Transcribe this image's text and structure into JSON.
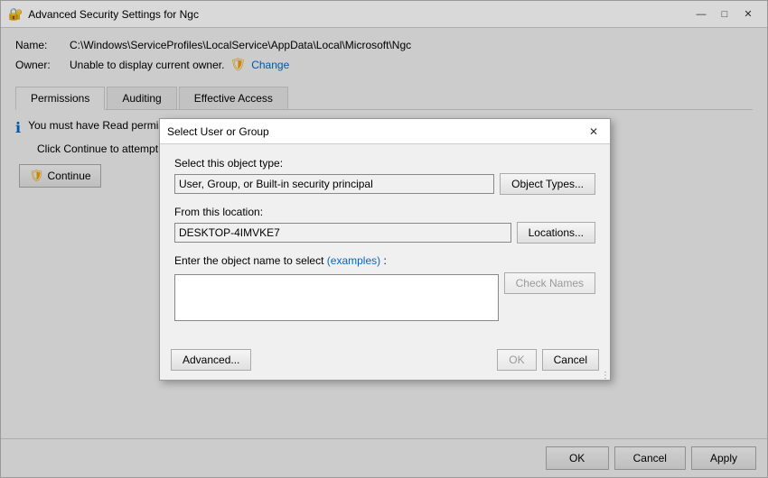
{
  "mainWindow": {
    "title": "Advanced Security Settings for Ngc",
    "titleIcon": "🔒"
  },
  "fields": {
    "nameLabel": "Name:",
    "nameValue": "C:\\Windows\\ServiceProfiles\\LocalService\\AppData\\Local\\Microsoft\\Ngc",
    "ownerLabel": "Owner:",
    "ownerValue": "Unable to display current owner.",
    "changeLink": "Change"
  },
  "tabs": [
    {
      "label": "Permissions",
      "active": true
    },
    {
      "label": "Auditing",
      "active": false
    },
    {
      "label": "Effective Access",
      "active": false
    }
  ],
  "infoText": {
    "line1": "You must have Read permissions to view the properties of this object.",
    "line2": "Click Continue to attempt the operation with administrative privileges."
  },
  "continueBtn": "Continue",
  "bottomBar": {
    "ok": "OK",
    "cancel": "Cancel",
    "apply": "Apply"
  },
  "dialog": {
    "title": "Select User or Group",
    "objectTypeLabel": "Select this object type:",
    "objectTypeValue": "User, Group, or Built-in security principal",
    "objectTypesBtn": "Object Types...",
    "locationLabel": "From this location:",
    "locationValue": "DESKTOP-4IMVKE7",
    "locationsBtn": "Locations...",
    "objectNameLabel": "Enter the object name to select",
    "examplesLabel": "(examples)",
    "checkNamesBtn": "Check Names",
    "advancedBtn": "Advanced...",
    "okBtn": "OK",
    "cancelBtn": "Cancel"
  },
  "icons": {
    "shield": "🛡",
    "info": "ℹ",
    "close": "✕",
    "minimize": "—",
    "maximize": "□",
    "continue": "🛡"
  }
}
